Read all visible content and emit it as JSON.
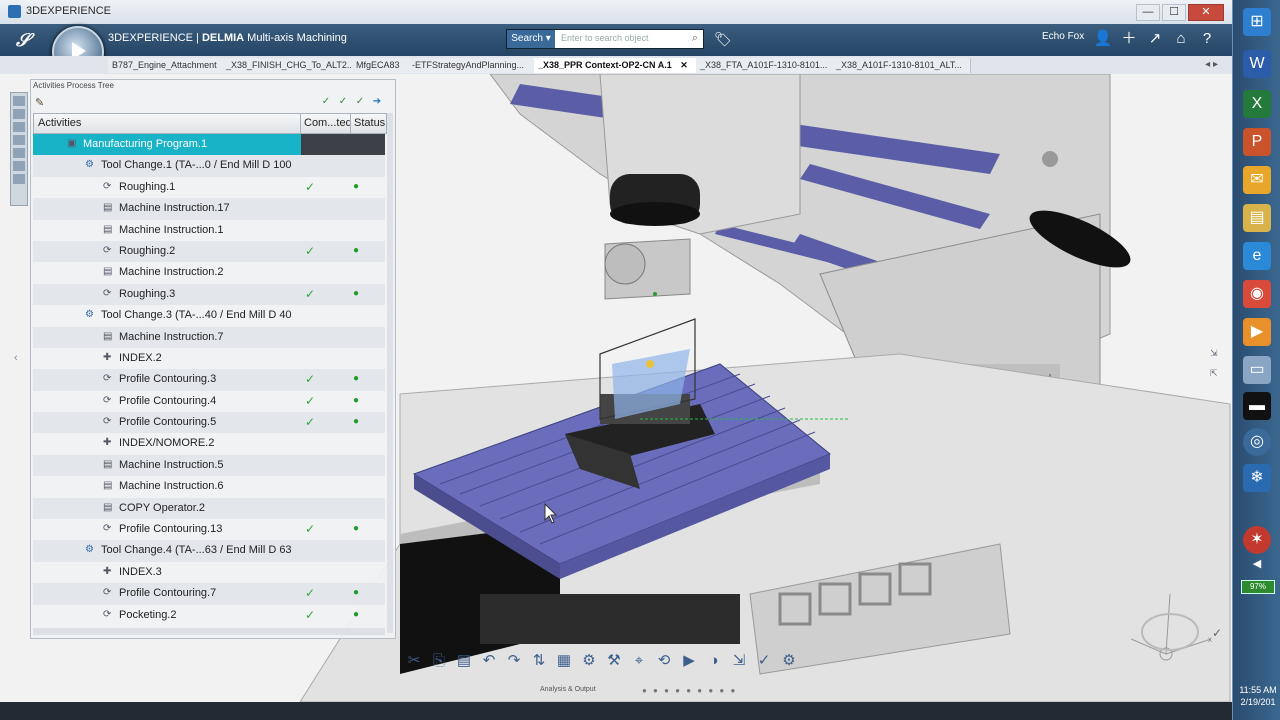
{
  "window": {
    "title": "3DEXPERIENCE",
    "min": "—",
    "max": "☐",
    "close": "✕"
  },
  "appbar": {
    "brand_prefix": "3DEXPERIENCE | ",
    "brand_app": "DELMIA",
    "brand_suffix": " Multi-axis Machining",
    "search_label": "Search ▾",
    "search_placeholder": "Enter to search object",
    "user": "Echo Fox"
  },
  "tabs": [
    {
      "label": "B787_Engine_Attachment"
    },
    {
      "label": "_X38_FINISH_CHG_To_ALT2..."
    },
    {
      "label": "MfgECA83"
    },
    {
      "label": "-ETFStrategyAndPlanning..."
    },
    {
      "label": "_X38_PPR Context-OP2-CN A.1",
      "close": "✕"
    },
    {
      "label": "_X38_FTA_A101F-1310-8101..."
    },
    {
      "label": "_X38_A101F-1310-8101_ALT..."
    }
  ],
  "panel": {
    "title": "Activities Process Tree",
    "col_activities": "Activities",
    "col_computed": "Com...ted",
    "col_status": "Status",
    "rows": [
      {
        "label": "Manufacturing Program.1",
        "type": "prog",
        "computed": "",
        "status": ""
      },
      {
        "label": "Tool Change.1 (TA-...0 / End Mill D 100",
        "type": "tc",
        "computed": "",
        "status": ""
      },
      {
        "label": "Roughing.1",
        "type": "op",
        "computed": "✓",
        "status": "●"
      },
      {
        "label": "Machine Instruction.17",
        "type": "mi",
        "computed": "",
        "status": ""
      },
      {
        "label": "Machine Instruction.1",
        "type": "mi",
        "computed": "",
        "status": ""
      },
      {
        "label": "Roughing.2",
        "type": "op",
        "computed": "✓",
        "status": "●"
      },
      {
        "label": "Machine Instruction.2",
        "type": "mi",
        "computed": "",
        "status": ""
      },
      {
        "label": "Roughing.3",
        "type": "op",
        "computed": "✓",
        "status": "●"
      },
      {
        "label": "Tool Change.3 (TA-...40 / End Mill D 40",
        "type": "tc",
        "computed": "",
        "status": ""
      },
      {
        "label": "Machine Instruction.7",
        "type": "mi",
        "computed": "",
        "status": ""
      },
      {
        "label": "INDEX.2",
        "type": "ix",
        "computed": "",
        "status": ""
      },
      {
        "label": "Profile Contouring.3",
        "type": "op",
        "computed": "✓",
        "status": "●"
      },
      {
        "label": "Profile Contouring.4",
        "type": "op",
        "computed": "✓",
        "status": "●"
      },
      {
        "label": "Profile Contouring.5",
        "type": "op",
        "computed": "✓",
        "status": "●"
      },
      {
        "label": "INDEX/NOMORE.2",
        "type": "ix",
        "computed": "",
        "status": ""
      },
      {
        "label": "Machine Instruction.5",
        "type": "mi",
        "computed": "",
        "status": ""
      },
      {
        "label": "Machine Instruction.6",
        "type": "mi",
        "computed": "",
        "status": ""
      },
      {
        "label": "COPY Operator.2",
        "type": "mi",
        "computed": "",
        "status": ""
      },
      {
        "label": "Profile Contouring.13",
        "type": "op",
        "computed": "✓",
        "status": "●"
      },
      {
        "label": "Tool Change.4 (TA-...63 / End Mill D 63",
        "type": "tc",
        "computed": "",
        "status": ""
      },
      {
        "label": "INDEX.3",
        "type": "ix",
        "computed": "",
        "status": ""
      },
      {
        "label": "Profile Contouring.7",
        "type": "op",
        "computed": "✓",
        "status": "●"
      },
      {
        "label": "Pocketing.2",
        "type": "op",
        "computed": "✓",
        "status": "●"
      }
    ]
  },
  "bottom": {
    "section_label": "Analysis & Output",
    "dots": "● ● ● ● ● ● ● ● ●"
  },
  "taskbar": {
    "battery": "97%",
    "time": "11:55 AM",
    "date": "2/19/201"
  },
  "icons": {
    "toolbar": [
      "cut-icon",
      "copy-icon",
      "paste-icon",
      "undo-icon",
      "redo-icon",
      "sort-icon",
      "table-icon",
      "machine-icon",
      "tool-icon",
      "measure-icon",
      "replay-icon",
      "simulate-icon",
      "analysis-icon",
      "output-icon",
      "check-icon",
      "settings-icon"
    ]
  }
}
